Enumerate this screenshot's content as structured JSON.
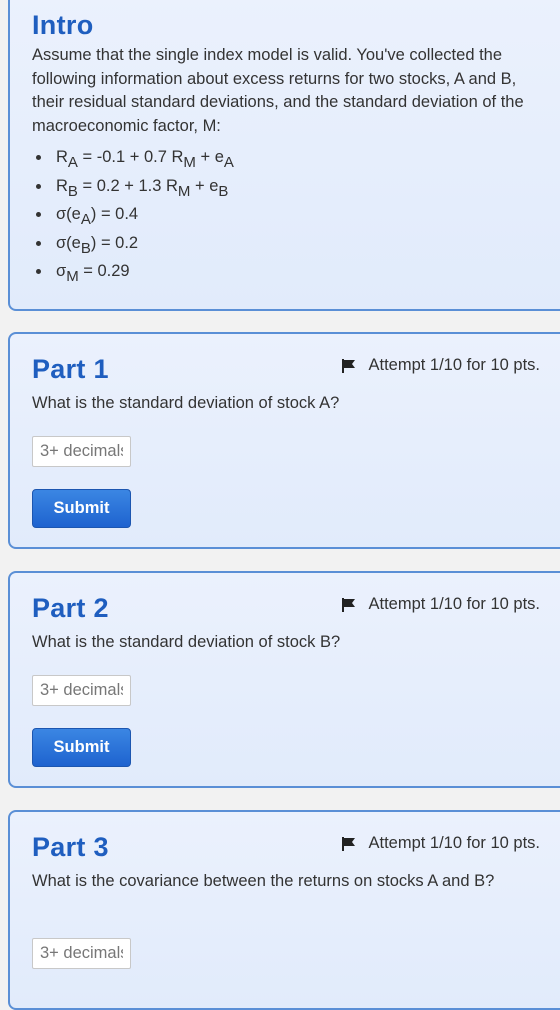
{
  "intro": {
    "title": "Intro",
    "description": "Assume that the single index model is valid. You've collected the following information about excess returns for two stocks, A and B, their residual standard deviations, and the standard deviation of the macroeconomic factor, M:",
    "formulas": [
      {
        "pre": "R",
        "sub1": "A",
        "mid": " = -0.1 + 0.7 R",
        "sub2": "M",
        "mid2": " + e",
        "sub3": "A"
      },
      {
        "pre": "R",
        "sub1": "B",
        "mid": " = 0.2 + 1.3 R",
        "sub2": "M",
        "mid2": " + e",
        "sub3": "B"
      },
      {
        "pre": "σ(e",
        "sub1": "A",
        "mid": ") = 0.4"
      },
      {
        "pre": "σ(e",
        "sub1": "B",
        "mid": ") = 0.2"
      },
      {
        "pre": "σ",
        "sub1": "M",
        "mid": " = 0.29"
      }
    ]
  },
  "parts": [
    {
      "title": "Part 1",
      "attempt": "Attempt 1/10 for 10 pts.",
      "question": "What is the standard deviation of stock A?",
      "placeholder": "3+ decimals",
      "submit_label": "Submit"
    },
    {
      "title": "Part 2",
      "attempt": "Attempt 1/10 for 10 pts.",
      "question": "What is the standard deviation of stock B?",
      "placeholder": "3+ decimals",
      "submit_label": "Submit"
    },
    {
      "title": "Part 3",
      "attempt": "Attempt 1/10 for 10 pts.",
      "question": "What is the covariance between the returns on stocks A and B?",
      "placeholder": "3+ decimals"
    }
  ],
  "colors": {
    "accent": "#1f5ebf",
    "card_border": "#5a8fd6",
    "button": "#1e63cf"
  }
}
